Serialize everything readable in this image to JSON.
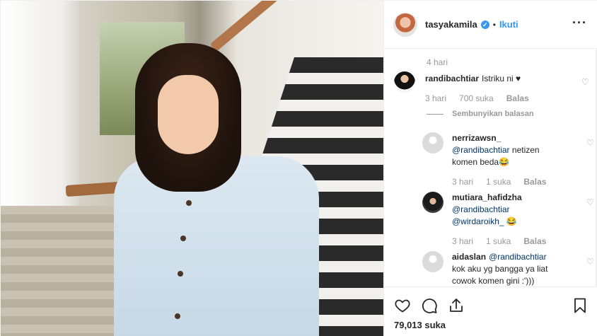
{
  "post": {
    "author": "tasyakamila",
    "follow_label": "Ikuti",
    "separator": "•",
    "more_label": "···",
    "post_age": "4 hari",
    "likes_text": "79,013 suka"
  },
  "comments": [
    {
      "user": "randibachtiar",
      "text": "Istriku ni ♥",
      "time": "3 hari",
      "likes": "700 suka",
      "reply_label": "Balas",
      "hide_replies_label": "Sembunyikan balasan",
      "replies": [
        {
          "user": "nerrizawsn_",
          "mention": "@randibachtiar",
          "text": " netizen komen beda😂",
          "time": "3 hari",
          "likes": "1 suka",
          "reply_label": "Balas"
        },
        {
          "user": "mutiara_hafidzha",
          "mention": "@randibachtiar",
          "mention2": "@wirdaroikh_",
          "text": " 😂",
          "time": "3 hari",
          "likes": "1 suka",
          "reply_label": "Balas"
        },
        {
          "user": "aidaslan",
          "mention": "@randibachtiar",
          "text": " kok aku yg bangga ya liat cowok komen gini :')))"
        }
      ]
    }
  ],
  "icons": {
    "verified": "verified-badge-icon",
    "like": "heart-icon",
    "comment": "comment-bubble-icon",
    "share": "share-icon",
    "save": "bookmark-icon"
  },
  "colors": {
    "accent": "#3897f0",
    "mention": "#003569",
    "muted": "#999999",
    "text": "#262626"
  }
}
